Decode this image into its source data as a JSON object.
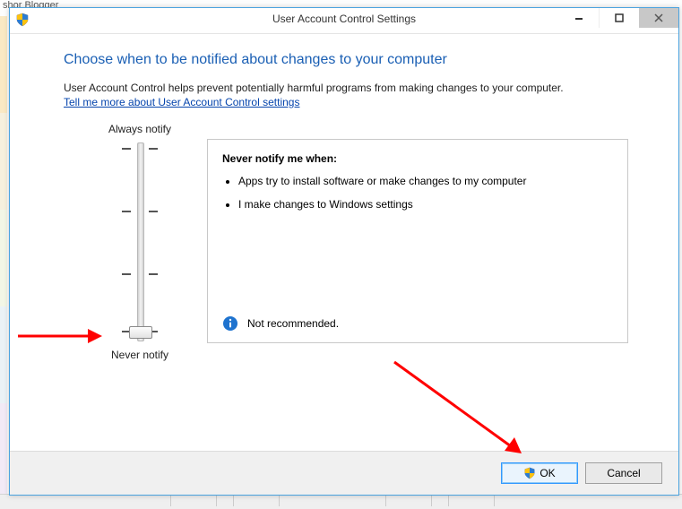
{
  "background": {
    "browser_tab_hint": "shor Blogger"
  },
  "window": {
    "title": "User Account Control Settings"
  },
  "content": {
    "heading": "Choose when to be notified about changes to your computer",
    "description": "User Account Control helps prevent potentially harmful programs from making changes to your computer.",
    "help_link": "Tell me more about User Account Control settings"
  },
  "slider": {
    "top_label": "Always notify",
    "bottom_label": "Never notify",
    "levels": 4,
    "current_level": 0
  },
  "info_panel": {
    "title": "Never notify me when:",
    "bullets": [
      "Apps try to install software or make changes to my computer",
      "I make changes to Windows settings"
    ],
    "footer": "Not recommended."
  },
  "buttons": {
    "ok": "OK",
    "cancel": "Cancel"
  }
}
